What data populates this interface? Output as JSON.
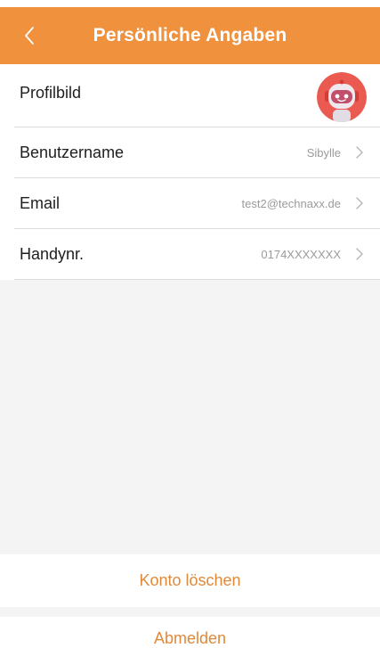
{
  "colors": {
    "accent": "#f0913d",
    "accent_text": "#e0893a",
    "background_grey": "#f4f4f4"
  },
  "header": {
    "title": "Persönliche Angaben",
    "back_icon": "chevron-left-icon"
  },
  "profile": {
    "picture_label": "Profilbild",
    "avatar_icon": "robot-avatar-icon"
  },
  "fields": [
    {
      "label": "Benutzername",
      "value": "Sibylle"
    },
    {
      "label": "Email",
      "value": "test2@technaxx.de"
    },
    {
      "label": "Handynr.",
      "value": "0174XXXXXXX"
    }
  ],
  "actions": {
    "delete_account": "Konto löschen",
    "logout": "Abmelden"
  }
}
